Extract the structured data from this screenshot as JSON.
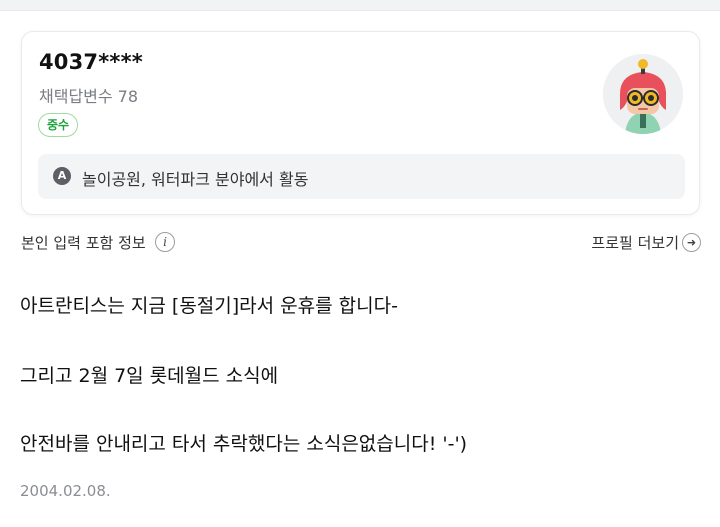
{
  "profile": {
    "username": "4037****",
    "adopted_answers": "채택답변수 78",
    "grade": "중수",
    "activity_icon_letter": "A",
    "activity": "놀이공원, 워터파크 분야에서 활동"
  },
  "info_row": {
    "self_info_label": "본인 입력 포함 정보",
    "info_icon_glyph": "i",
    "profile_more_label": "프로필 더보기",
    "arrow_glyph": "➜"
  },
  "answer": {
    "lines": [
      "아트란티스는 지금 [동절기]라서 운휴를 합니다-",
      "그리고 2월 7일 롯데월드 소식에",
      "안전바를 안내리고 타서 추락했다는 소식은없습니다! '-')"
    ],
    "date": "2004.02.08."
  },
  "icons": {
    "avatar": "avatar-character-icon",
    "activity": "activity-icon",
    "info": "info-icon",
    "arrow": "arrow-right-circle-icon"
  },
  "colors": {
    "grade_green": "#1aa33a",
    "avatar_hair": "#e8505b",
    "activity_bg": "#f3f4f6"
  }
}
